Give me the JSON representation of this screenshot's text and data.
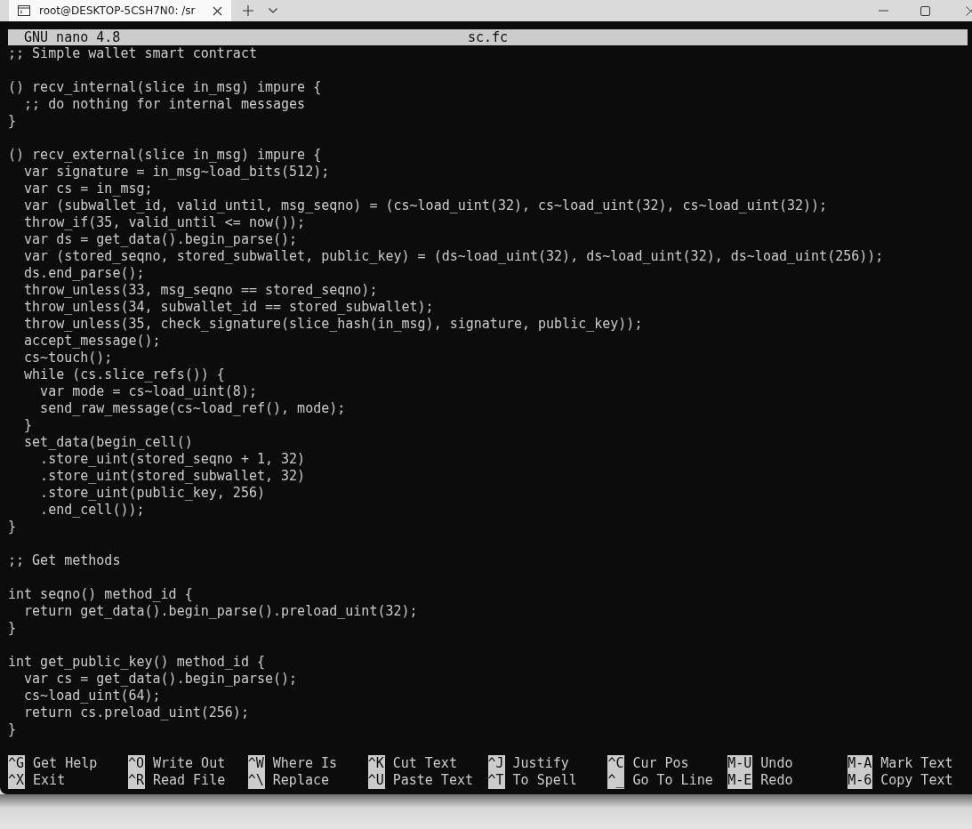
{
  "window": {
    "tab_title": "root@DESKTOP-5CSH7N0: /sr"
  },
  "nano": {
    "version": "GNU nano 4.8",
    "filename": "sc.fc"
  },
  "code_blocks": [
    [
      ";; Simple wallet smart contract"
    ],
    [
      "() recv_internal(slice in_msg) impure {",
      "  ;; do nothing for internal messages",
      "}"
    ],
    [
      "() recv_external(slice in_msg) impure {",
      "  var signature = in_msg~load_bits(512);",
      "  var cs = in_msg;",
      "  var (subwallet_id, valid_until, msg_seqno) = (cs~load_uint(32), cs~load_uint(32), cs~load_uint(32));",
      "  throw_if(35, valid_until <= now());",
      "  var ds = get_data().begin_parse();",
      "  var (stored_seqno, stored_subwallet, public_key) = (ds~load_uint(32), ds~load_uint(32), ds~load_uint(256));",
      "  ds.end_parse();",
      "  throw_unless(33, msg_seqno == stored_seqno);",
      "  throw_unless(34, subwallet_id == stored_subwallet);",
      "  throw_unless(35, check_signature(slice_hash(in_msg), signature, public_key));",
      "  accept_message();",
      "  cs~touch();",
      "  while (cs.slice_refs()) {",
      "    var mode = cs~load_uint(8);",
      "    send_raw_message(cs~load_ref(), mode);",
      "  }",
      "  set_data(begin_cell()",
      "    .store_uint(stored_seqno + 1, 32)",
      "    .store_uint(stored_subwallet, 32)",
      "    .store_uint(public_key, 256)",
      "    .end_cell());",
      "}"
    ],
    [
      ";; Get methods"
    ],
    [
      "int seqno() method_id {",
      "  return get_data().begin_parse().preload_uint(32);",
      "}"
    ],
    [
      "int get_public_key() method_id {",
      "  var cs = get_data().begin_parse();",
      "  cs~load_uint(64);",
      "  return cs.preload_uint(256);",
      "}"
    ]
  ],
  "shortcuts": [
    [
      {
        "key": "^G",
        "label": "Get Help"
      },
      {
        "key": "^X",
        "label": "Exit"
      }
    ],
    [
      {
        "key": "^O",
        "label": "Write Out"
      },
      {
        "key": "^R",
        "label": "Read File"
      }
    ],
    [
      {
        "key": "^W",
        "label": "Where Is"
      },
      {
        "key": "^\\",
        "label": "Replace"
      }
    ],
    [
      {
        "key": "^K",
        "label": "Cut Text"
      },
      {
        "key": "^U",
        "label": "Paste Text"
      }
    ],
    [
      {
        "key": "^J",
        "label": "Justify"
      },
      {
        "key": "^T",
        "label": "To Spell"
      }
    ],
    [
      {
        "key": "^C",
        "label": "Cur Pos"
      },
      {
        "key": "^_",
        "label": "Go To Line"
      }
    ],
    [
      {
        "key": "M-U",
        "label": "Undo"
      },
      {
        "key": "M-E",
        "label": "Redo"
      }
    ],
    [
      {
        "key": "M-A",
        "label": "Mark Text"
      },
      {
        "key": "M-6",
        "label": "Copy Text"
      }
    ]
  ]
}
